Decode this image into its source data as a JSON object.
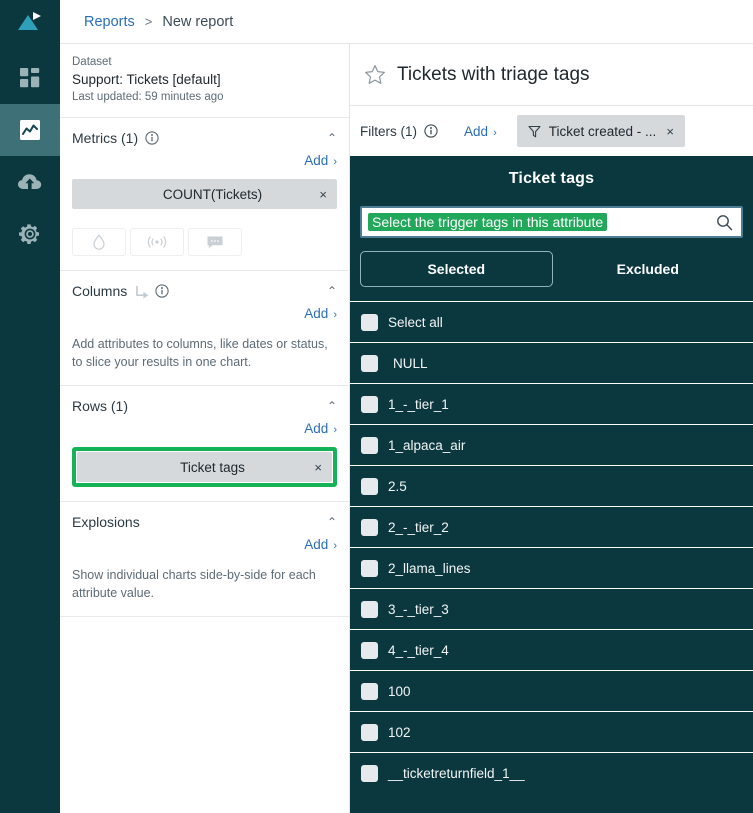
{
  "rail": {
    "logo_name": "app-logo",
    "items": [
      {
        "name": "dashboard",
        "icon": "grid-icon",
        "active": false
      },
      {
        "name": "reports",
        "icon": "chart-icon",
        "active": true
      },
      {
        "name": "uploads",
        "icon": "cloud-upload-icon",
        "active": false
      },
      {
        "name": "settings",
        "icon": "gear-icon",
        "active": false
      }
    ]
  },
  "breadcrumb": {
    "root": "Reports",
    "separator": ">",
    "current": "New report"
  },
  "dataset": {
    "label": "Dataset",
    "name": "Support: Tickets [default]",
    "updated": "Last updated: 59 minutes ago"
  },
  "panel": {
    "metrics": {
      "title": "Metrics (1)",
      "add_label": "Add",
      "chips": [
        {
          "label": "COUNT(Tickets)",
          "remove": "×"
        }
      ],
      "mini_buttons": [
        {
          "name": "droplet-icon"
        },
        {
          "name": "signal-icon"
        },
        {
          "name": "chat-icon"
        }
      ]
    },
    "columns": {
      "title": "Columns",
      "add_label": "Add",
      "hint": "Add attributes to columns, like dates or status, to slice your results in one chart."
    },
    "rows": {
      "title": "Rows (1)",
      "add_label": "Add",
      "chips": [
        {
          "label": "Ticket tags",
          "remove": "×",
          "highlighted": true
        }
      ]
    },
    "explosions": {
      "title": "Explosions",
      "add_label": "Add",
      "hint": "Show individual charts side-by-side for each attribute value."
    },
    "chevron": "⌃"
  },
  "report": {
    "title": "Tickets with triage tags",
    "filters": {
      "label": "Filters (1)",
      "add_label": "Add",
      "chip": {
        "text": "Ticket created - ...",
        "remove": "×"
      }
    }
  },
  "picker": {
    "title": "Ticket tags",
    "search_placeholder": "Select the trigger tags in this attribute",
    "tabs": [
      {
        "label": "Selected",
        "active": true
      },
      {
        "label": "Excluded",
        "active": false
      }
    ],
    "rows": [
      {
        "label": "Select all",
        "checked": false,
        "indent": false
      },
      {
        "label": "NULL",
        "checked": false,
        "indent": true
      },
      {
        "label": "1_-_tier_1",
        "checked": false,
        "indent": false
      },
      {
        "label": "1_alpaca_air",
        "checked": false,
        "indent": false
      },
      {
        "label": "2.5",
        "checked": false,
        "indent": false
      },
      {
        "label": "2_-_tier_2",
        "checked": false,
        "indent": false
      },
      {
        "label": "2_llama_lines",
        "checked": false,
        "indent": false
      },
      {
        "label": "3_-_tier_3",
        "checked": false,
        "indent": false
      },
      {
        "label": "4_-_tier_4",
        "checked": false,
        "indent": false
      },
      {
        "label": "100",
        "checked": false,
        "indent": false
      },
      {
        "label": "102",
        "checked": false,
        "indent": false
      },
      {
        "label": "__ticketreturnfield_1__",
        "checked": false,
        "indent": false
      }
    ]
  },
  "colors": {
    "teal_dark": "#0b383f",
    "teal_active": "#3d7077",
    "link_blue": "#2a6ebb",
    "highlight_green": "#15b257",
    "search_highlight_green": "#22a85a",
    "chip_grey": "#d5d9dc"
  }
}
